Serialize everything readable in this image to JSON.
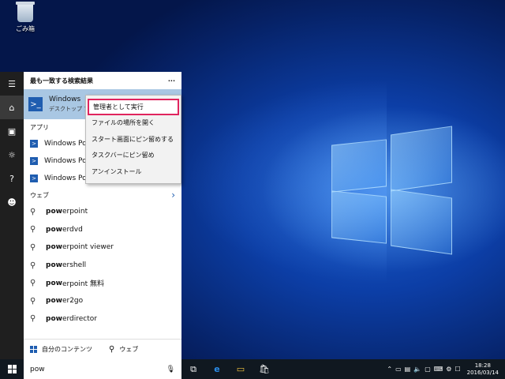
{
  "desktop": {
    "recycle_label": "ごみ箱"
  },
  "start_menu": {
    "header_title": "最も一致する検索結果",
    "header_more": "···",
    "best_match": {
      "title": "Windows",
      "subtitle": "デスクトップ ア"
    },
    "apps_section": "アプリ",
    "apps": [
      {
        "label": "Windows Po"
      },
      {
        "label": "Windows Po"
      },
      {
        "label": "Windows Po"
      }
    ],
    "web_section": "ウェブ",
    "web_arrow": "›",
    "web_results": [
      {
        "bold": "pow",
        "rest": "erpoint"
      },
      {
        "bold": "pow",
        "rest": "erdvd"
      },
      {
        "bold": "pow",
        "rest": "erpoint viewer"
      },
      {
        "bold": "pow",
        "rest": "ershell"
      },
      {
        "bold": "pow",
        "rest": "erpoint 無料"
      },
      {
        "bold": "pow",
        "rest": "er2go"
      },
      {
        "bold": "pow",
        "rest": "erdirector"
      }
    ],
    "footer_my_content": "自分のコンテンツ",
    "footer_web": "ウェブ"
  },
  "context_menu": {
    "items": [
      {
        "label": "管理者として実行"
      },
      {
        "label": "ファイルの場所を開く"
      },
      {
        "label": "スタート画面にピン留めする"
      },
      {
        "label": "タスクバーにピン留め"
      },
      {
        "label": "アンインストール"
      }
    ]
  },
  "taskbar": {
    "search_value": "pow",
    "time": "18:28",
    "date": "2016/03/14"
  },
  "colors": {
    "highlight_border": "#e0245e",
    "best_match_bg": "#a9c7e3",
    "accent": "#1f5db0"
  }
}
